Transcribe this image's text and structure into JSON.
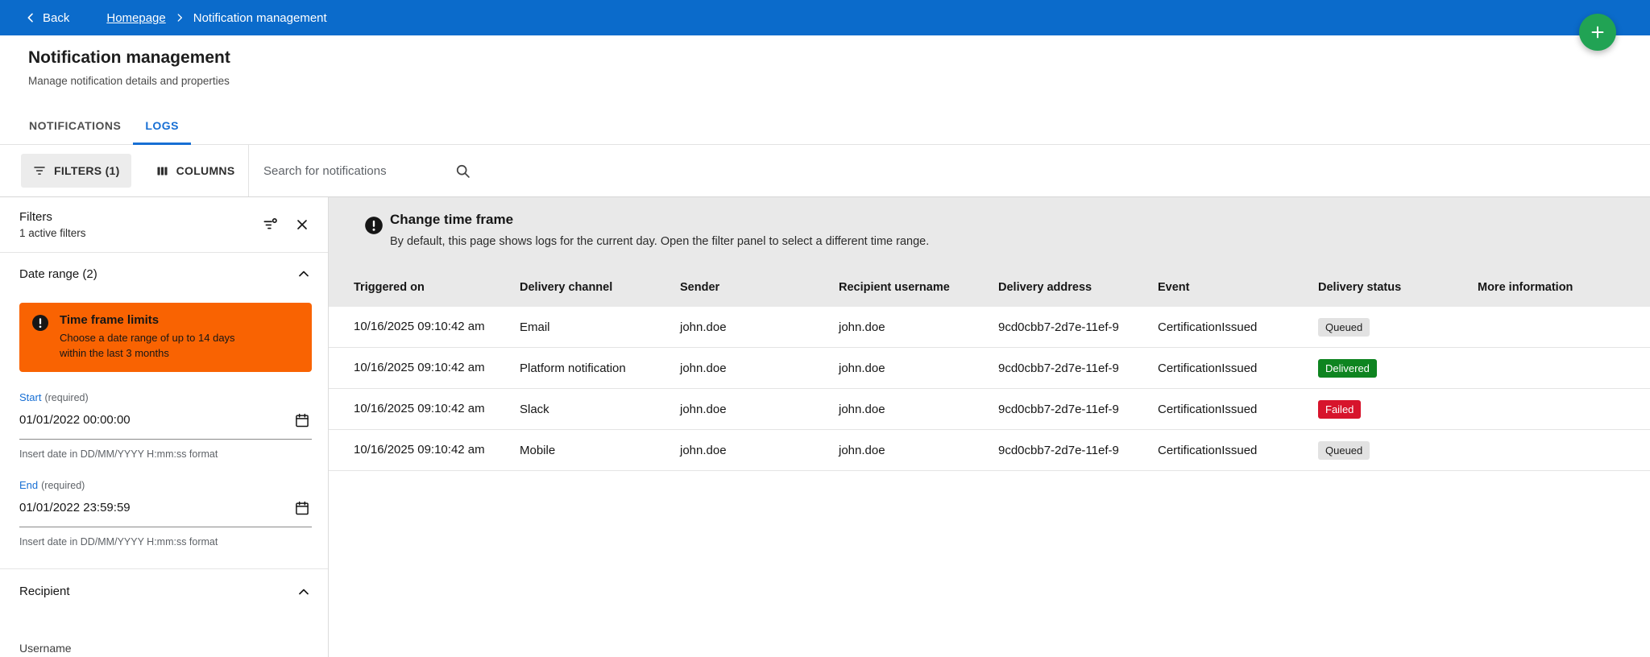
{
  "colors": {
    "topbar_blue": "#0b6bcb",
    "accent_blue": "#176fd4",
    "warning_orange": "#f96302",
    "fab_green": "#21a354",
    "delivered_green": "#0e8420",
    "failed_red": "#d7142c",
    "queued_gray": "#e2e2e2",
    "banner_gray": "#e9e9e9"
  },
  "topbar": {
    "back_label": "Back",
    "breadcrumb": [
      "Homepage",
      "Notification management"
    ]
  },
  "header": {
    "title": "Notification management",
    "subtitle": "Manage notification details and properties"
  },
  "tabs": [
    {
      "label": "NOTIFICATIONS"
    },
    {
      "label": "LOGS"
    }
  ],
  "toolbar": {
    "filters_label": "FILTERS (1)",
    "columns_label": "COLUMNS",
    "search_placeholder": "Search for notifications"
  },
  "filter_panel": {
    "title": "Filters",
    "active_filters_label": "1 active filters",
    "date_range": {
      "section_label": "Date range (2)",
      "warning_title": "Time frame limits",
      "warning_body": "Choose a date range of up to 14 days within the last 3 months",
      "start_label": "Start",
      "start_required": "(required)",
      "start_value": "01/01/2022 00:00:00",
      "start_helper": "Insert date in DD/MM/YYYY H:mm:ss format",
      "end_label": "End",
      "end_required": "(required)",
      "end_value": "01/01/2022 23:59:59",
      "end_helper": "Insert date in DD/MM/YYYY H:mm:ss format"
    },
    "recipient": {
      "section_label": "Recipient",
      "username_label": "Username"
    }
  },
  "banner": {
    "title": "Change time frame",
    "body": "By default, this page shows logs for the current day. Open the filter panel to select a different time range."
  },
  "table": {
    "columns": [
      "Triggered on",
      "Delivery channel",
      "Sender",
      "Recipient username",
      "Delivery address",
      "Event",
      "Delivery status",
      "More information"
    ],
    "rows": [
      {
        "triggered_on": "10/16/2025 09:10:42 am",
        "channel": "Email",
        "sender": "john.doe",
        "recipient": "john.doe",
        "address": "9cd0cbb7-2d7e-11ef-9",
        "event": "CertificationIssued",
        "status": "Queued",
        "status_type": "queued"
      },
      {
        "triggered_on": "10/16/2025 09:10:42 am",
        "channel": "Platform notification",
        "sender": "john.doe",
        "recipient": "john.doe",
        "address": "9cd0cbb7-2d7e-11ef-9",
        "event": "CertificationIssued",
        "status": "Delivered",
        "status_type": "delivered"
      },
      {
        "triggered_on": "10/16/2025 09:10:42 am",
        "channel": "Slack",
        "sender": "john.doe",
        "recipient": "john.doe",
        "address": "9cd0cbb7-2d7e-11ef-9",
        "event": "CertificationIssued",
        "status": "Failed",
        "status_type": "failed"
      },
      {
        "triggered_on": "10/16/2025 09:10:42 am",
        "channel": "Mobile",
        "sender": "john.doe",
        "recipient": "john.doe",
        "address": "9cd0cbb7-2d7e-11ef-9",
        "event": "CertificationIssued",
        "status": "Queued",
        "status_type": "queued"
      }
    ]
  }
}
